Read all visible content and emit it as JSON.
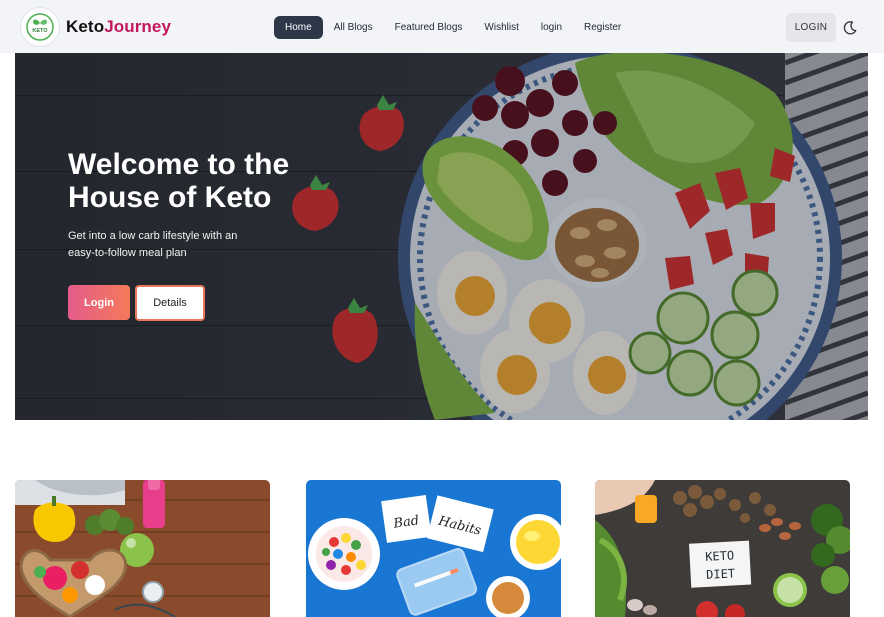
{
  "navbar": {
    "brand_part1": "Keto",
    "brand_part2": "Journey",
    "logo_text": "KETO",
    "links": [
      {
        "label": "Home",
        "active": true
      },
      {
        "label": "All Blogs",
        "active": false
      },
      {
        "label": "Featured Blogs",
        "active": false
      },
      {
        "label": "Wishlist",
        "active": false
      },
      {
        "label": "login",
        "active": false
      },
      {
        "label": "Register",
        "active": false
      }
    ],
    "login_button": "LOGIN",
    "theme_icon": "moon-icon"
  },
  "hero": {
    "title_line1": "Welcome to the",
    "title_line2": "House of Keto",
    "subtitle_line1": "Get into a low carb lifestyle with an",
    "subtitle_line2": "easy-to-follow meal plan",
    "login_button": "Login",
    "details_button": "Details"
  },
  "cards": [
    {
      "image": "healthy-food-heart-plate"
    },
    {
      "image": "bad-habits-notes",
      "note1": "Bad",
      "note2": "Habits"
    },
    {
      "image": "keto-diet-ingredients",
      "note_line1": "KETO",
      "note_line2": "DIET"
    }
  ],
  "colors": {
    "brand_accent": "#c2185b",
    "nav_active_bg": "#2d3748",
    "gradient_start": "#e45c8a",
    "gradient_end": "#f47a5a"
  }
}
